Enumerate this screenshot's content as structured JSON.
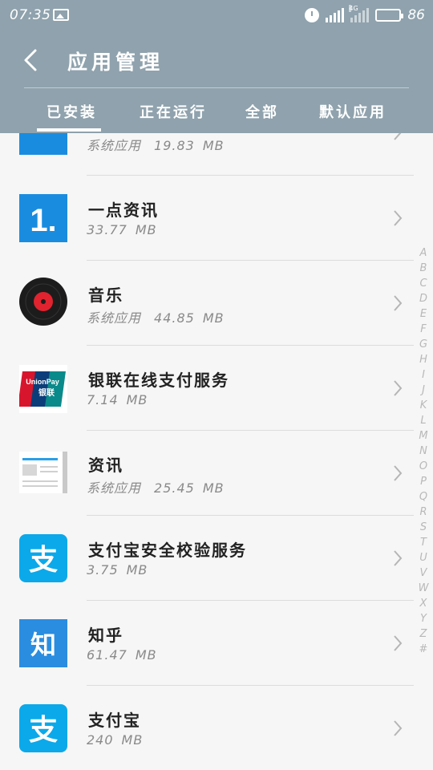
{
  "status_bar": {
    "time": "07:35",
    "network_label": "4G",
    "battery_percent": "86",
    "battery_level": 0.86
  },
  "header": {
    "title": "应用管理",
    "tabs": [
      {
        "label": "已安装",
        "active": true
      },
      {
        "label": "正在运行",
        "active": false
      },
      {
        "label": "全部",
        "active": false
      },
      {
        "label": "默认应用",
        "active": false
      }
    ]
  },
  "apps": [
    {
      "name": "",
      "system_label": "系统应用",
      "size": "19.83",
      "unit": "MB",
      "icon": "blue-app-icon"
    },
    {
      "name": "一点资讯",
      "system_label": "",
      "size": "33.77",
      "unit": "MB",
      "icon": "yidian-icon"
    },
    {
      "name": "音乐",
      "system_label": "系统应用",
      "size": "44.85",
      "unit": "MB",
      "icon": "music-record-icon"
    },
    {
      "name": "银联在线支付服务",
      "system_label": "",
      "size": "7.14",
      "unit": "MB",
      "icon": "unionpay-icon"
    },
    {
      "name": "资讯",
      "system_label": "系统应用",
      "size": "25.45",
      "unit": "MB",
      "icon": "news-icon"
    },
    {
      "name": "支付宝安全校验服务",
      "system_label": "",
      "size": "3.75",
      "unit": "MB",
      "icon": "alipay-icon"
    },
    {
      "name": "知乎",
      "system_label": "",
      "size": "61.47",
      "unit": "MB",
      "icon": "zhihu-icon"
    },
    {
      "name": "支付宝",
      "system_label": "",
      "size": "240",
      "unit": "MB",
      "icon": "alipay-icon"
    }
  ],
  "alphabet": [
    "A",
    "B",
    "C",
    "D",
    "E",
    "F",
    "G",
    "H",
    "I",
    "J",
    "K",
    "L",
    "M",
    "N",
    "O",
    "P",
    "Q",
    "R",
    "S",
    "T",
    "U",
    "V",
    "W",
    "X",
    "Y",
    "Z",
    "#"
  ],
  "icon_text": {
    "yidian": "1.",
    "unionpay_en": "UnionPay",
    "unionpay_cn": "银联",
    "alipay_char": "支",
    "zhihu": "知"
  },
  "colors": {
    "header_bg": "#8fa2ad",
    "accent_blue": "#1a8ce0",
    "alipay_blue": "#0ba9ea",
    "zhihu_blue": "#2a8de0",
    "unionpay_red": "#d7162d"
  }
}
